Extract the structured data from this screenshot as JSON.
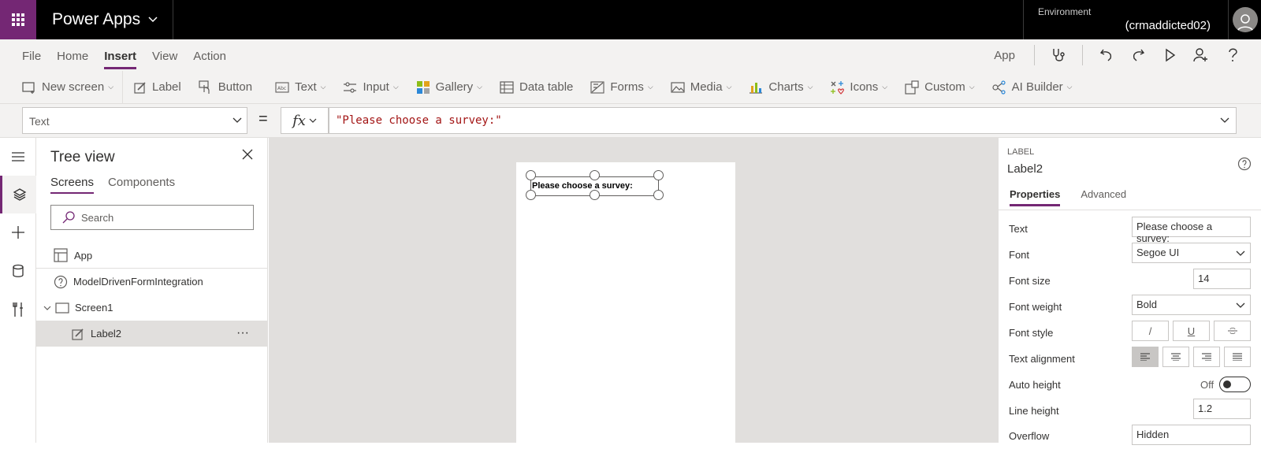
{
  "app": {
    "title": "Power Apps",
    "env_label": "Environment",
    "env_name": "(crmaddicted02)"
  },
  "menu": {
    "items": [
      "File",
      "Home",
      "Insert",
      "View",
      "Action"
    ],
    "active": "Insert",
    "app_label": "App"
  },
  "toolbar": {
    "items": [
      "New screen",
      "Label",
      "Button",
      "Text",
      "Input",
      "Gallery",
      "Data table",
      "Forms",
      "Media",
      "Charts",
      "Icons",
      "Custom",
      "AI Builder"
    ]
  },
  "formula": {
    "property": "Text",
    "eq": "=",
    "fx": "fx",
    "value": "\"Please choose a survey:\""
  },
  "tree": {
    "title": "Tree view",
    "tabs": [
      "Screens",
      "Components"
    ],
    "search_placeholder": "Search",
    "nodes": [
      "App",
      "ModelDrivenFormIntegration",
      "Screen1",
      "Label2"
    ],
    "more": "···"
  },
  "canvas": {
    "label_text": "Please choose a survey:"
  },
  "properties": {
    "type": "LABEL",
    "name": "Label2",
    "tabs": [
      "Properties",
      "Advanced"
    ],
    "rows": {
      "text_label": "Text",
      "text_value": "Please choose a survey:",
      "font_label": "Font",
      "font_value": "Segoe UI",
      "font_size_label": "Font size",
      "font_size_value": "14",
      "font_weight_label": "Font weight",
      "font_weight_value": "Bold",
      "font_style_label": "Font style",
      "italic": "/",
      "underline": "U",
      "text_align_label": "Text alignment",
      "auto_height_label": "Auto height",
      "auto_height_value": "Off",
      "line_height_label": "Line height",
      "line_height_value": "1.2",
      "overflow_label": "Overflow",
      "overflow_value": "Hidden"
    }
  },
  "colors": {
    "brand": "#742774",
    "formula_text": "#a31515"
  }
}
